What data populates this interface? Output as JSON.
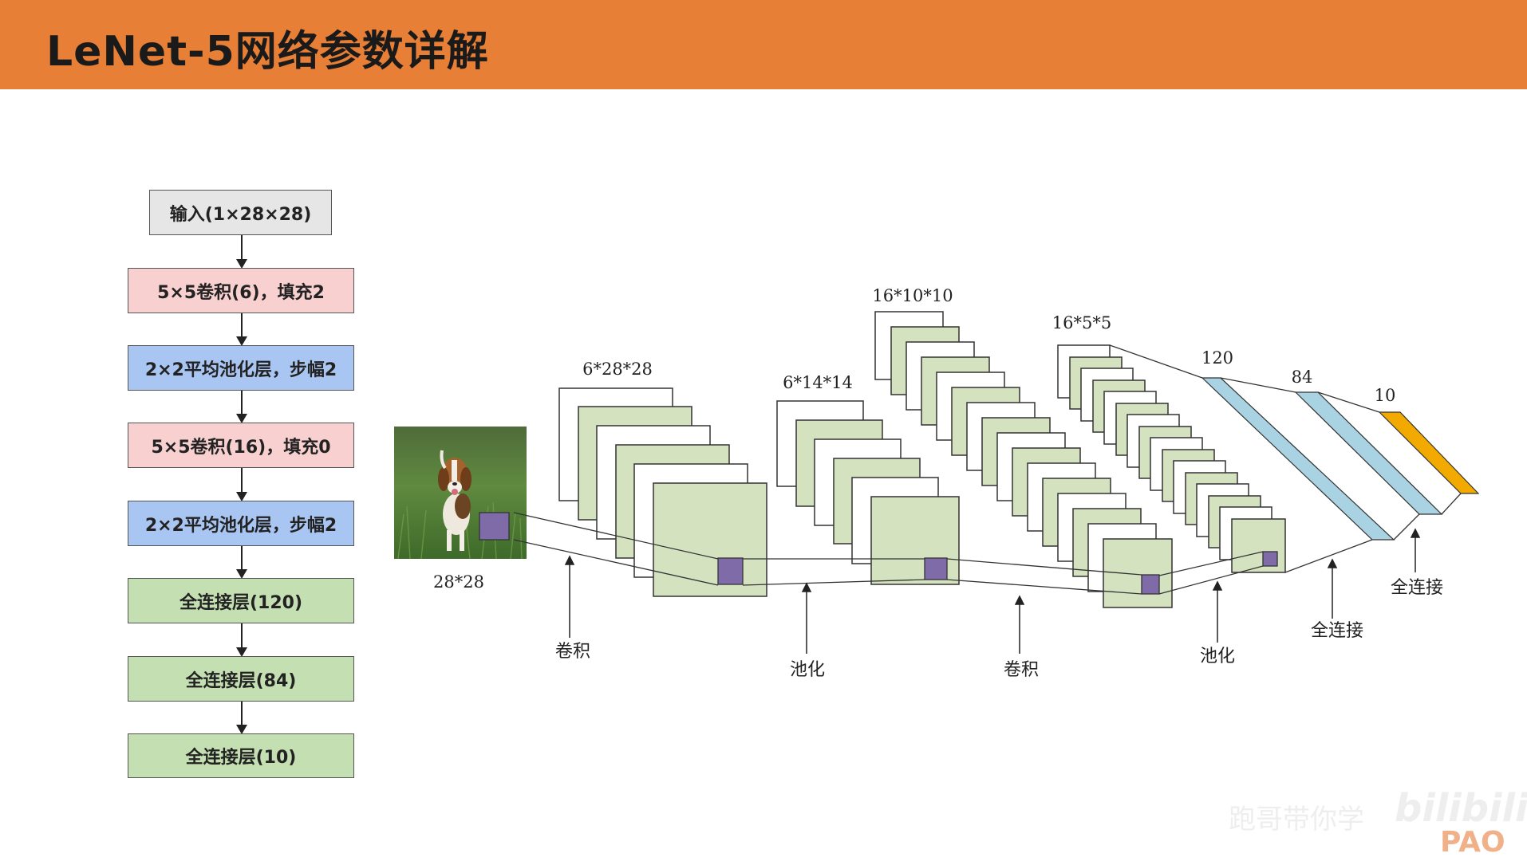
{
  "title": "LeNet-5网络参数详解",
  "flowchart": {
    "boxes": [
      {
        "label": "输入(1×28×28)",
        "color": "#E6E6E6"
      },
      {
        "label": "5×5卷积(6)，填充2",
        "color": "#F8D0D0"
      },
      {
        "label": "2×2平均池化层，步幅2",
        "color": "#A9C5F2"
      },
      {
        "label": "5×5卷积(16)，填充0",
        "color": "#F8D0D0"
      },
      {
        "label": "2×2平均池化层，步幅2",
        "color": "#A9C5F2"
      },
      {
        "label": "全连接层(120)",
        "color": "#C4DFB2"
      },
      {
        "label": "全连接层(84)",
        "color": "#C4DFB2"
      },
      {
        "label": "全连接层(10)",
        "color": "#C4DFB2"
      }
    ]
  },
  "diagram": {
    "input_label": "28*28",
    "fmap_labels": [
      "6*28*28",
      "6*14*14",
      "16*10*10",
      "16*5*5"
    ],
    "fc_labels": [
      "120",
      "84",
      "10"
    ],
    "op_labels": [
      "卷积",
      "池化",
      "卷积",
      "池化",
      "全连接",
      "全连接"
    ],
    "colors": {
      "fmap": "#D5E2C0",
      "kernel": "#7E6BA8",
      "fc": "#A9D2E3",
      "output": "#F2A900"
    }
  },
  "watermark": {
    "text": "跑哥带你学",
    "brand": "bilibili",
    "logo": "PAO"
  }
}
